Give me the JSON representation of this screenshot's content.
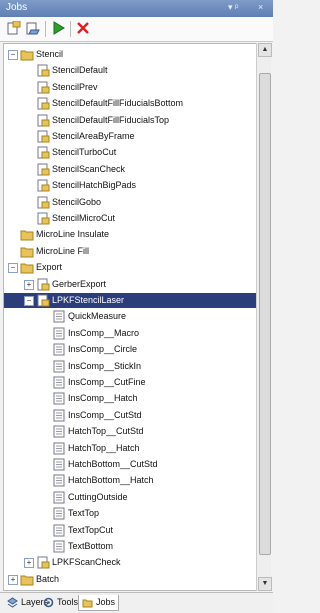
{
  "window": {
    "title": "Jobs",
    "pin_glyph": "▾ ᵖ",
    "close_glyph": "×"
  },
  "toolbar": {
    "buttons": [
      {
        "name": "new-job-button",
        "icon": "new-job-icon"
      },
      {
        "name": "open-job-button",
        "icon": "open-job-icon"
      },
      {
        "name": "run-button",
        "icon": "play-icon"
      },
      {
        "name": "delete-button",
        "icon": "delete-icon"
      }
    ]
  },
  "tree": {
    "items": [
      {
        "label": "Stencil",
        "level": 0,
        "expander": "minus",
        "icon": "folder"
      },
      {
        "label": "StencilDefault",
        "level": 1,
        "icon": "job"
      },
      {
        "label": "StencilPrev",
        "level": 1,
        "icon": "job"
      },
      {
        "label": "StencilDefaultFillFiducialsBottom",
        "level": 1,
        "icon": "job"
      },
      {
        "label": "StencilDefaultFillFiducialsTop",
        "level": 1,
        "icon": "job"
      },
      {
        "label": "StencilAreaByFrame",
        "level": 1,
        "icon": "job"
      },
      {
        "label": "StencilTurboCut",
        "level": 1,
        "icon": "job"
      },
      {
        "label": "StencilScanCheck",
        "level": 1,
        "icon": "job"
      },
      {
        "label": "StencilHatchBigPads",
        "level": 1,
        "icon": "job"
      },
      {
        "label": "StencilGobo",
        "level": 1,
        "icon": "job"
      },
      {
        "label": "StencilMicroCut",
        "level": 1,
        "icon": "job"
      },
      {
        "label": "MicroLine Insulate",
        "level": 0,
        "icon": "folder"
      },
      {
        "label": "MicroLine Fill",
        "level": 0,
        "icon": "folder"
      },
      {
        "label": "Export",
        "level": 0,
        "expander": "minus",
        "icon": "folder"
      },
      {
        "label": "GerberExport",
        "level": 1,
        "expander": "plus",
        "icon": "job"
      },
      {
        "label": "LPKFStencilLaser",
        "level": 1,
        "expander": "minus",
        "icon": "job",
        "selected": true
      },
      {
        "label": "QuickMeasure",
        "level": 2,
        "icon": "doc"
      },
      {
        "label": "InsComp__Macro",
        "level": 2,
        "icon": "doc"
      },
      {
        "label": "InsComp__Circle",
        "level": 2,
        "icon": "doc"
      },
      {
        "label": "InsComp__StickIn",
        "level": 2,
        "icon": "doc"
      },
      {
        "label": "InsComp__CutFine",
        "level": 2,
        "icon": "doc"
      },
      {
        "label": "InsComp__Hatch",
        "level": 2,
        "icon": "doc"
      },
      {
        "label": "InsComp__CutStd",
        "level": 2,
        "icon": "doc"
      },
      {
        "label": "HatchTop__CutStd",
        "level": 2,
        "icon": "doc"
      },
      {
        "label": "HatchTop__Hatch",
        "level": 2,
        "icon": "doc"
      },
      {
        "label": "HatchBottom__CutStd",
        "level": 2,
        "icon": "doc"
      },
      {
        "label": "HatchBottom__Hatch",
        "level": 2,
        "icon": "doc"
      },
      {
        "label": "CuttingOutside",
        "level": 2,
        "icon": "doc"
      },
      {
        "label": "TextTop",
        "level": 2,
        "icon": "doc"
      },
      {
        "label": "TextTopCut",
        "level": 2,
        "icon": "doc"
      },
      {
        "label": "TextBottom",
        "level": 2,
        "icon": "doc"
      },
      {
        "label": "LPKFScanCheck",
        "level": 1,
        "expander": "plus",
        "icon": "job"
      },
      {
        "label": "Batch",
        "level": 0,
        "expander": "plus",
        "icon": "folder"
      }
    ]
  },
  "tabs": [
    {
      "label": "Layers",
      "icon": "layers-icon",
      "active": false
    },
    {
      "label": "Tools",
      "icon": "tools-icon",
      "active": false
    },
    {
      "label": "Jobs",
      "icon": "jobs-icon",
      "active": true
    }
  ],
  "colors": {
    "selection": "#2b3d7a",
    "titlebar": "#6f8dbe",
    "folder": "#e8c25a"
  }
}
